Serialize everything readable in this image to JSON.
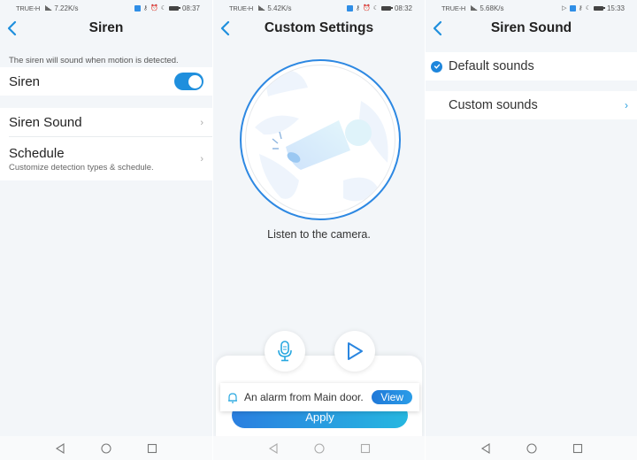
{
  "screens": [
    {
      "statusbar": {
        "carrier": "TRUE-H",
        "speed": "7.22K/s",
        "time": "08:37"
      },
      "title": "Siren",
      "hint": "The siren will sound when motion is detected.",
      "siren_row": {
        "label": "Siren",
        "toggle_on": true
      },
      "items": [
        {
          "label": "Siren Sound",
          "sub": ""
        },
        {
          "label": "Schedule",
          "sub": "Customize detection types & schedule."
        }
      ]
    },
    {
      "statusbar": {
        "carrier": "TRUE-H",
        "speed": "5.42K/s",
        "time": "08:32"
      },
      "title": "Custom Settings",
      "illustration": "camera-illustration",
      "caption": "Listen to the camera.",
      "mic_button": "microphone-icon",
      "play_button": "play-icon",
      "toast": {
        "icon": "bell-icon",
        "message": "An alarm from Main door.",
        "action": "View"
      },
      "apply_label": "Apply"
    },
    {
      "statusbar": {
        "carrier": "TRUE-H",
        "speed": "5.68K/s",
        "time": "15:33"
      },
      "title": "Siren Sound",
      "options": [
        {
          "label": "Default sounds",
          "selected": true
        },
        {
          "label": "Custom sounds",
          "selected": false
        }
      ]
    }
  ],
  "colors": {
    "accent": "#1f8fdd",
    "ring": "#2d88e2",
    "background": "#f3f6f9"
  }
}
